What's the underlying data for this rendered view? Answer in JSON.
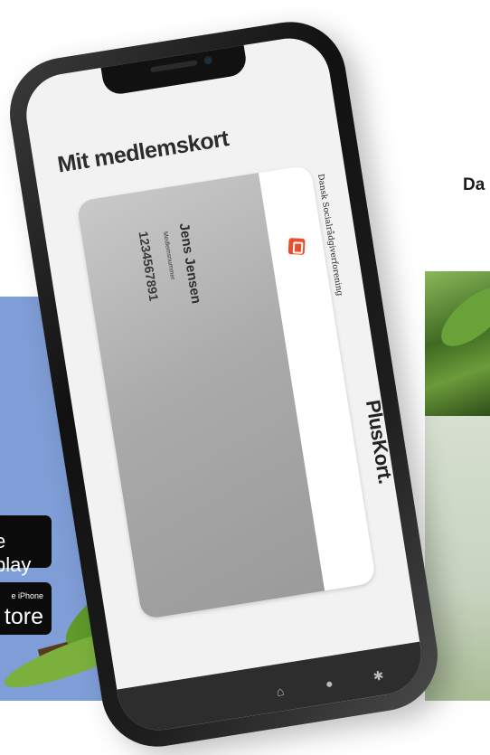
{
  "screen": {
    "title": "Mit medlemskort"
  },
  "card": {
    "organization": "Dansk Socialrådgiverforening",
    "brand": "PlusKort.",
    "member_name": "Jens Jensen",
    "member_number_label": "Medlemsnummer",
    "member_number": "1234567891"
  },
  "store_buttons": {
    "google_play_label": "e play",
    "app_store_small": "e iPhone",
    "app_store_big": "tore"
  },
  "background": {
    "partial_heading": "Da"
  },
  "tab_bar": {
    "icons": [
      "home-icon",
      "user-icon",
      "settings-icon"
    ]
  },
  "colors": {
    "background_panel": "#7f9dd6",
    "card_gray": "#aaaaaa",
    "logo_accent": "#e94e2c",
    "store_button": "#0b0b0b"
  }
}
